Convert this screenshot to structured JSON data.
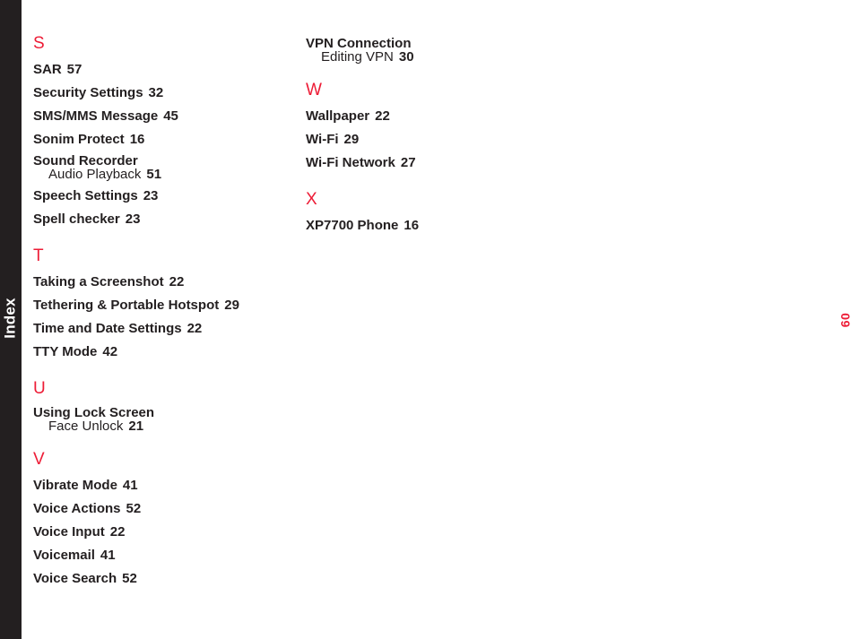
{
  "page": {
    "number": "60",
    "tab_label": "Index",
    "accent_color": "#ed1c36",
    "text_color": "#231f20",
    "tab_color": "#231f20"
  },
  "columns": [
    {
      "name": "left",
      "sections": [
        {
          "letter": "S",
          "entries": [
            {
              "title": "SAR",
              "page": "57",
              "subs": []
            },
            {
              "title": "Security Settings",
              "page": "32",
              "subs": []
            },
            {
              "title": "SMS/MMS Message",
              "page": "45",
              "subs": []
            },
            {
              "title": "Sonim Protect",
              "page": "16",
              "subs": []
            },
            {
              "title": "Sound Recorder",
              "page": "",
              "subs": [
                {
                  "title": "Audio Playback",
                  "page": "51"
                }
              ]
            },
            {
              "title": "Speech Settings",
              "page": "23",
              "subs": []
            },
            {
              "title": "Spell checker",
              "page": "23",
              "subs": []
            }
          ]
        },
        {
          "letter": "T",
          "entries": [
            {
              "title": "Taking a Screenshot",
              "page": "22",
              "subs": []
            },
            {
              "title": "Tethering & Portable Hotspot",
              "page": "29",
              "subs": []
            },
            {
              "title": "Time and Date Settings",
              "page": "22",
              "subs": []
            },
            {
              "title": "TTY Mode",
              "page": "42",
              "subs": []
            }
          ]
        },
        {
          "letter": "U",
          "entries": [
            {
              "title": "Using Lock Screen",
              "page": "",
              "subs": [
                {
                  "title": "Face Unlock",
                  "page": "21"
                }
              ]
            }
          ]
        },
        {
          "letter": "V",
          "entries": [
            {
              "title": "Vibrate Mode",
              "page": "41",
              "subs": []
            },
            {
              "title": "Voice Actions",
              "page": "52",
              "subs": []
            },
            {
              "title": "Voice Input",
              "page": "22",
              "subs": []
            },
            {
              "title": "Voicemail",
              "page": "41",
              "subs": []
            },
            {
              "title": "Voice Search",
              "page": "52",
              "subs": []
            }
          ]
        }
      ]
    },
    {
      "name": "right",
      "sections": [
        {
          "letter": "",
          "entries": [
            {
              "title": "VPN Connection",
              "page": "",
              "subs": [
                {
                  "title": "Editing VPN",
                  "page": "30"
                }
              ]
            }
          ]
        },
        {
          "letter": "W",
          "entries": [
            {
              "title": "Wallpaper",
              "page": "22",
              "subs": []
            },
            {
              "title": "Wi-Fi",
              "page": "29",
              "subs": []
            },
            {
              "title": "Wi-Fi Network",
              "page": "27",
              "subs": []
            }
          ]
        },
        {
          "letter": "X",
          "entries": [
            {
              "title": "XP7700 Phone",
              "page": "16",
              "subs": []
            }
          ]
        }
      ]
    }
  ]
}
